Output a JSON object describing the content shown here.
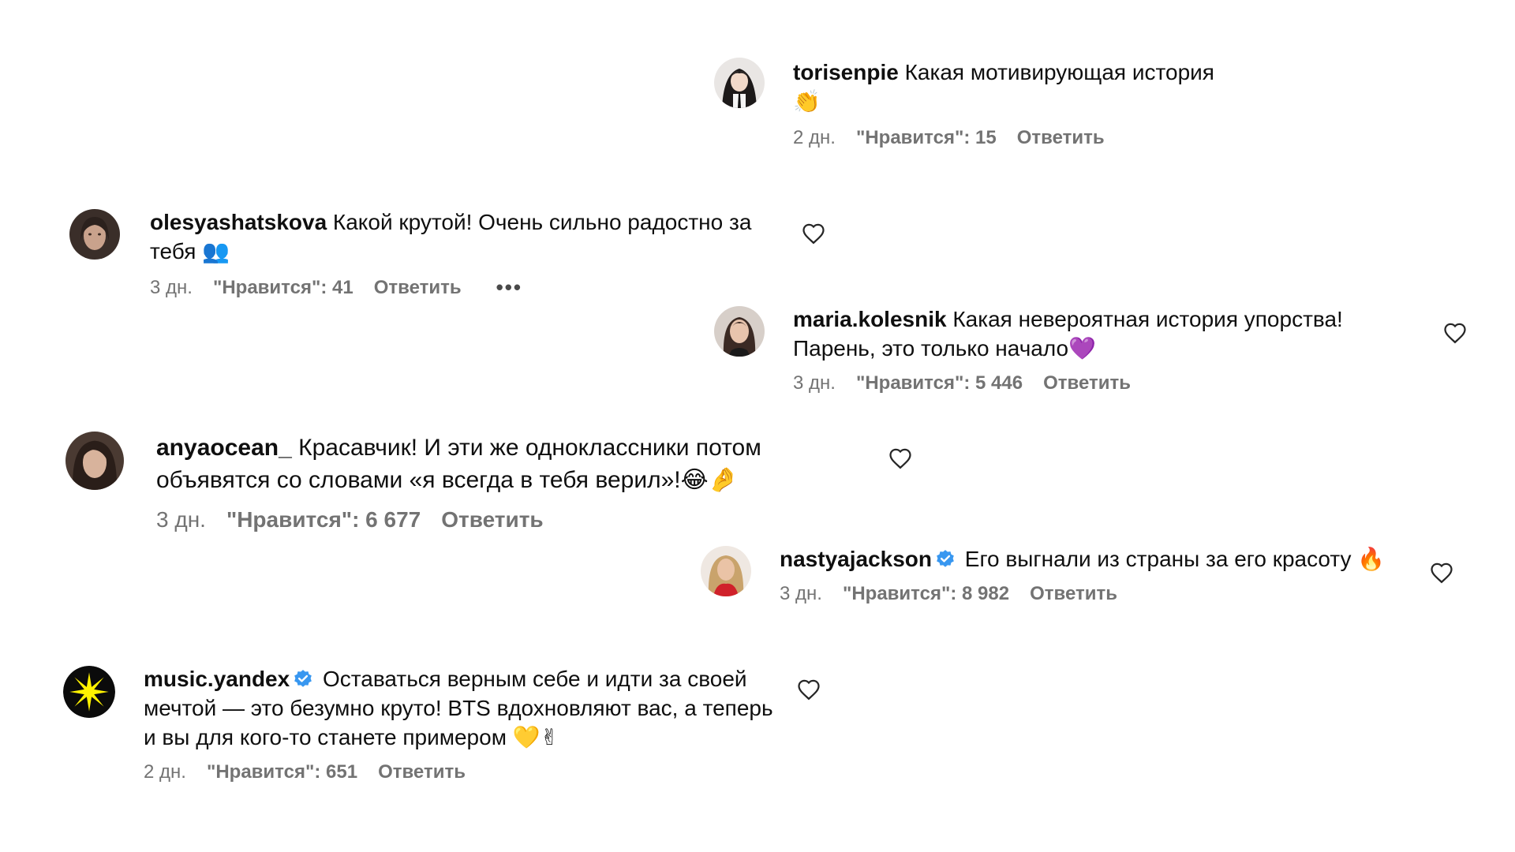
{
  "comments": [
    {
      "username": "torisenpie",
      "text": "Какая мотивирующая история",
      "emoji": "👏",
      "time": "2 дн.",
      "likes": "\"Нравится\": 15",
      "reply": "Ответить",
      "avatar_icon": "torisenpie-avatar"
    },
    {
      "username": "olesyashatskova",
      "text": "Какой крутой! Очень сильно радостно за тебя",
      "emoji": "👥",
      "time": "3 дн.",
      "likes": "\"Нравится\": 41",
      "reply": "Ответить",
      "more": "•••",
      "avatar_icon": "olesyashatskova-avatar"
    },
    {
      "username": "maria.kolesnik",
      "text": "Какая невероятная история упорства! Парень, это только начало",
      "emoji": "💜",
      "time": "3 дн.",
      "likes": "\"Нравится\": 5 446",
      "reply": "Ответить",
      "avatar_icon": "maria-kolesnik-avatar"
    },
    {
      "username": "anyaocean_",
      "text": "Красавчик! И эти же одноклассники потом объявятся со словами «я всегда в тебя верил»!",
      "emoji": "😂🤌",
      "time": "3 дн.",
      "likes": "\"Нравится\": 6 677",
      "reply": "Ответить",
      "avatar_icon": "anyaocean-avatar"
    },
    {
      "username": "nastyajackson",
      "verified": true,
      "text": "Его выгнали из страны за его красоту",
      "emoji": "🔥",
      "time": "3 дн.",
      "likes": "\"Нравится\": 8 982",
      "reply": "Ответить",
      "avatar_icon": "nastyajackson-avatar"
    },
    {
      "username": "music.yandex",
      "verified": true,
      "text": "Оставаться верным себе и идти за своей мечтой — это безумно круто! BTS вдохновляют вас, а теперь и вы для кого-то станете примером",
      "emoji": "💛✌",
      "time": "2 дн.",
      "likes": "\"Нравится\": 651",
      "reply": "Ответить",
      "avatar_icon": "yandex-music-logo"
    }
  ],
  "icons": {
    "heart": "heart-outline-icon",
    "verified": "verified-badge-icon"
  },
  "colors": {
    "verified": "#3897f0",
    "meta": "#737373",
    "yandex_logo_bg": "#0b0b0b",
    "yandex_logo_star": "#fff200"
  }
}
